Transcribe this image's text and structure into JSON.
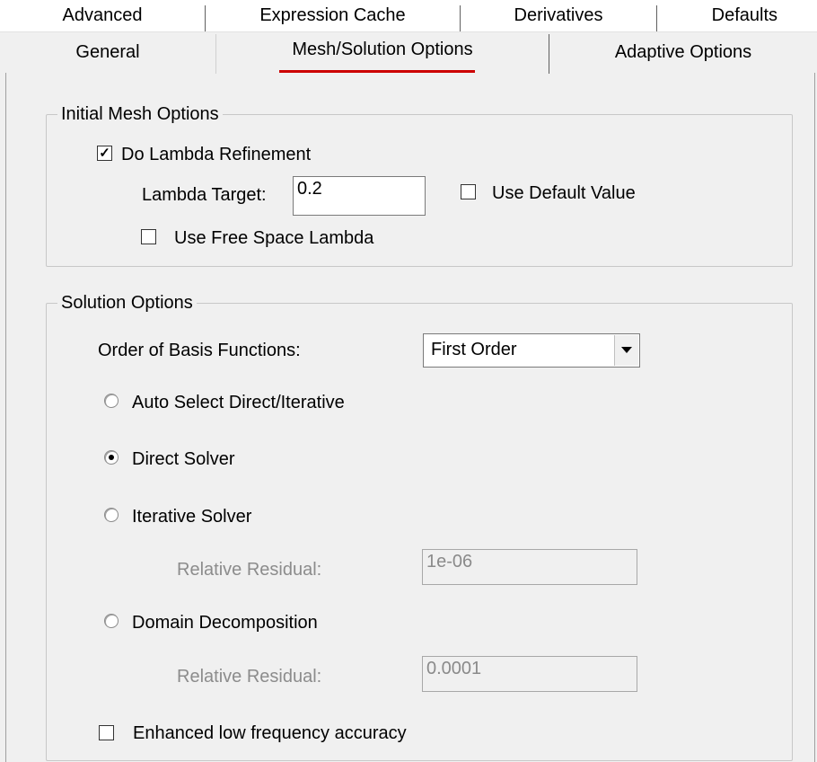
{
  "tabs": {
    "row1": [
      "Advanced",
      "Expression Cache",
      "Derivatives",
      "Defaults"
    ],
    "row2": [
      "General",
      "Mesh/Solution Options",
      "Adaptive Options"
    ],
    "active": "Mesh/Solution Options"
  },
  "initial_mesh": {
    "title": "Initial Mesh Options",
    "lambda_refinement": {
      "label": "Do Lambda Refinement",
      "checked": true
    },
    "lambda_target": {
      "label": "Lambda Target:",
      "value": "0.2"
    },
    "use_default": {
      "label": "Use Default Value",
      "checked": false
    },
    "free_space": {
      "label": "Use Free Space Lambda",
      "checked": false
    }
  },
  "solution": {
    "title": "Solution Options",
    "order_label": "Order of Basis Functions:",
    "order_value": "First Order",
    "auto_select": {
      "label": "Auto Select Direct/Iterative",
      "selected": false
    },
    "direct": {
      "label": "Direct Solver",
      "selected": true
    },
    "iterative": {
      "label": "Iterative Solver",
      "selected": false
    },
    "iterative_residual": {
      "label": "Relative Residual:",
      "value": "1e-06"
    },
    "domain": {
      "label": "Domain Decomposition",
      "selected": false
    },
    "domain_residual": {
      "label": "Relative Residual:",
      "value": "0.0001"
    },
    "low_freq": {
      "label": "Enhanced low frequency accuracy",
      "checked": false
    }
  },
  "icons": {
    "check": "checkmark-icon",
    "dropdown": "triangle-down-icon"
  },
  "colors": {
    "active_tab_underline": "#cc0000",
    "disabled_text": "#8c8c8c"
  }
}
